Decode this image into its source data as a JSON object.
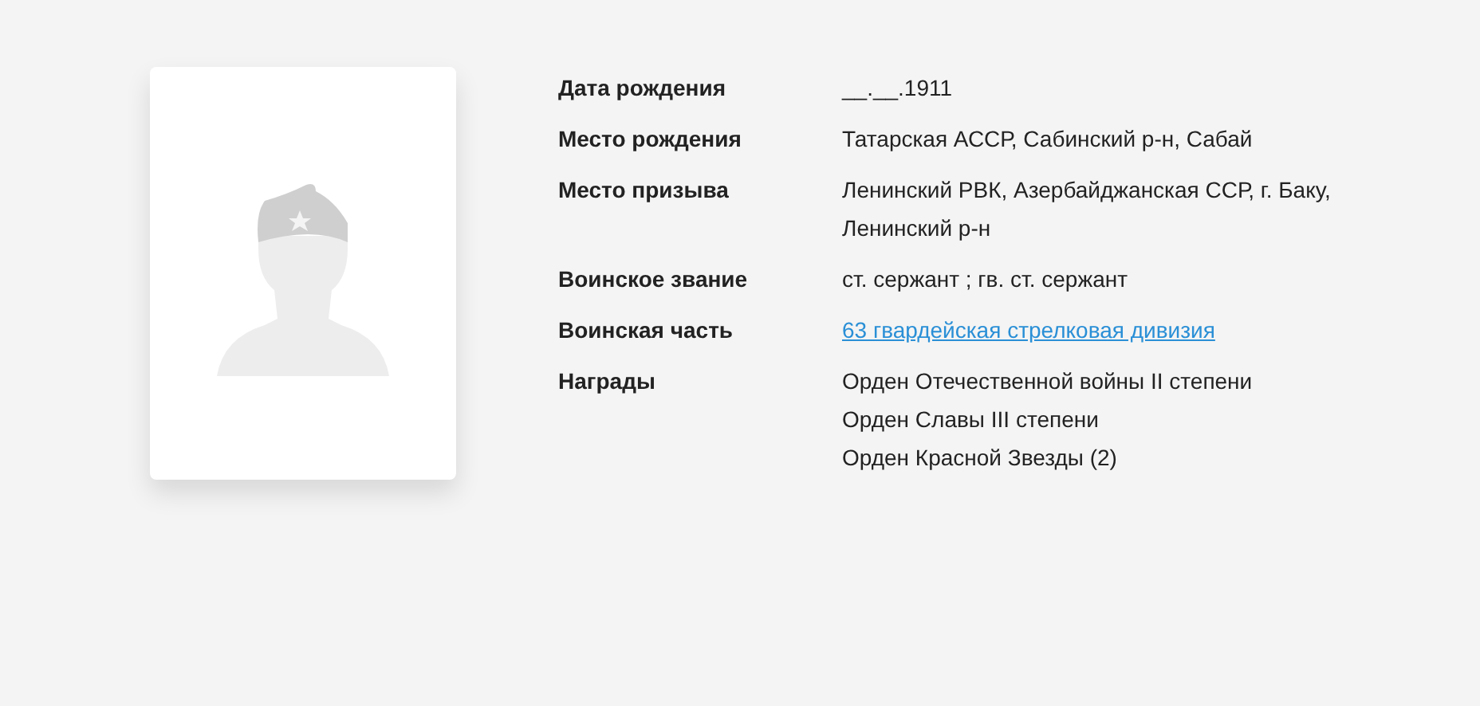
{
  "fields": [
    {
      "label": "Дата рождения",
      "kind": "text",
      "values": [
        "__.__.1911"
      ]
    },
    {
      "label": "Место рождения",
      "kind": "text",
      "values": [
        "Татарская АССР, Сабинский р-н, Сабай"
      ]
    },
    {
      "label": "Место призыва",
      "kind": "text",
      "values": [
        "Ленинский РВК, Азербайджанская ССР, г. Баку, Ленинский р-н"
      ]
    },
    {
      "label": "Воинское звание",
      "kind": "text",
      "values": [
        "ст. сержант ; гв. ст. сержант"
      ]
    },
    {
      "label": "Воинская часть",
      "kind": "link",
      "values": [
        "63 гвардейская стрелковая дивизия"
      ]
    },
    {
      "label": "Награды",
      "kind": "text",
      "values": [
        "Орден Отечественной войны II степени",
        "Орден Славы III степени",
        "Орден Красной Звезды (2)"
      ]
    }
  ]
}
